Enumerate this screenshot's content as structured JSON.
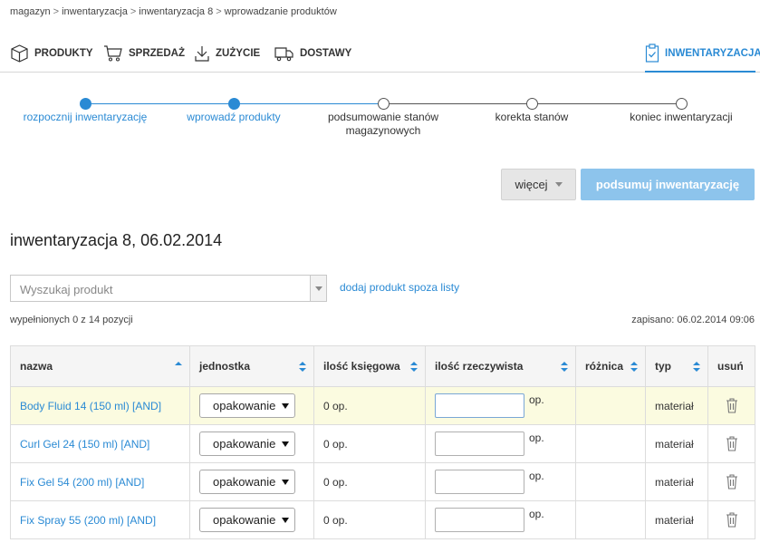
{
  "breadcrumb": [
    "magazyn",
    "inwentaryzacja",
    "inwentaryzacja 8",
    "wprowadzanie produktów"
  ],
  "breadcrumb_sep": ">",
  "nav": {
    "items": [
      {
        "label": "PRODUKTY",
        "icon": "box-icon"
      },
      {
        "label": "SPRZEDAŻ",
        "icon": "cart-icon"
      },
      {
        "label": "ZUŻYCIE",
        "icon": "download-icon"
      },
      {
        "label": "DOSTAWY",
        "icon": "truck-icon"
      }
    ],
    "active": {
      "label": "INWENTARYZACJA",
      "icon": "clipboard-check-icon"
    }
  },
  "steps": [
    {
      "label_line1": "rozpocznij inwentaryzację",
      "label_line2": "",
      "state": "done"
    },
    {
      "label_line1": "wprowadź produkty",
      "label_line2": "",
      "state": "done"
    },
    {
      "label_line1": "podsumowanie stanów",
      "label_line2": "magazynowych",
      "state": "todo"
    },
    {
      "label_line1": "korekta stanów",
      "label_line2": "",
      "state": "todo"
    },
    {
      "label_line1": "koniec inwentaryzacji",
      "label_line2": "",
      "state": "todo"
    }
  ],
  "actions": {
    "more_label": "więcej",
    "summary_label": "podsumuj inwentaryzację"
  },
  "title": "inwentaryzacja 8, 06.02.2014",
  "search": {
    "placeholder": "Wyszukaj produkt",
    "add_link": "dodaj produkt spoza listy"
  },
  "status": {
    "filled": "wypełnionych 0 z 14 pozycji",
    "saved": "zapisano: 06.02.2014 09:06"
  },
  "table": {
    "headers": [
      "nazwa",
      "jednostka",
      "ilość księgowa",
      "ilość rzeczywista",
      "różnica",
      "typ",
      "usuń"
    ],
    "rows": [
      {
        "name": "Body Fluid 14 (150 ml) [AND]",
        "unit": "opakowanie",
        "book_qty": "0 op.",
        "actual_qty": "",
        "actual_unit": "op.",
        "diff": "",
        "type": "materiał"
      },
      {
        "name": "Curl Gel 24 (150 ml) [AND]",
        "unit": "opakowanie",
        "book_qty": "0 op.",
        "actual_qty": "",
        "actual_unit": "op.",
        "diff": "",
        "type": "materiał"
      },
      {
        "name": "Fix Gel 54 (200 ml) [AND]",
        "unit": "opakowanie",
        "book_qty": "0 op.",
        "actual_qty": "",
        "actual_unit": "op.",
        "diff": "",
        "type": "materiał"
      },
      {
        "name": "Fix Spray 55 (200 ml) [AND]",
        "unit": "opakowanie",
        "book_qty": "0 op.",
        "actual_qty": "",
        "actual_unit": "op.",
        "diff": "",
        "type": "materiał"
      }
    ]
  },
  "colors": {
    "accent": "#2a8ad4",
    "summary_button": "#8dc4ec",
    "highlight_row": "#fbfbe0"
  }
}
